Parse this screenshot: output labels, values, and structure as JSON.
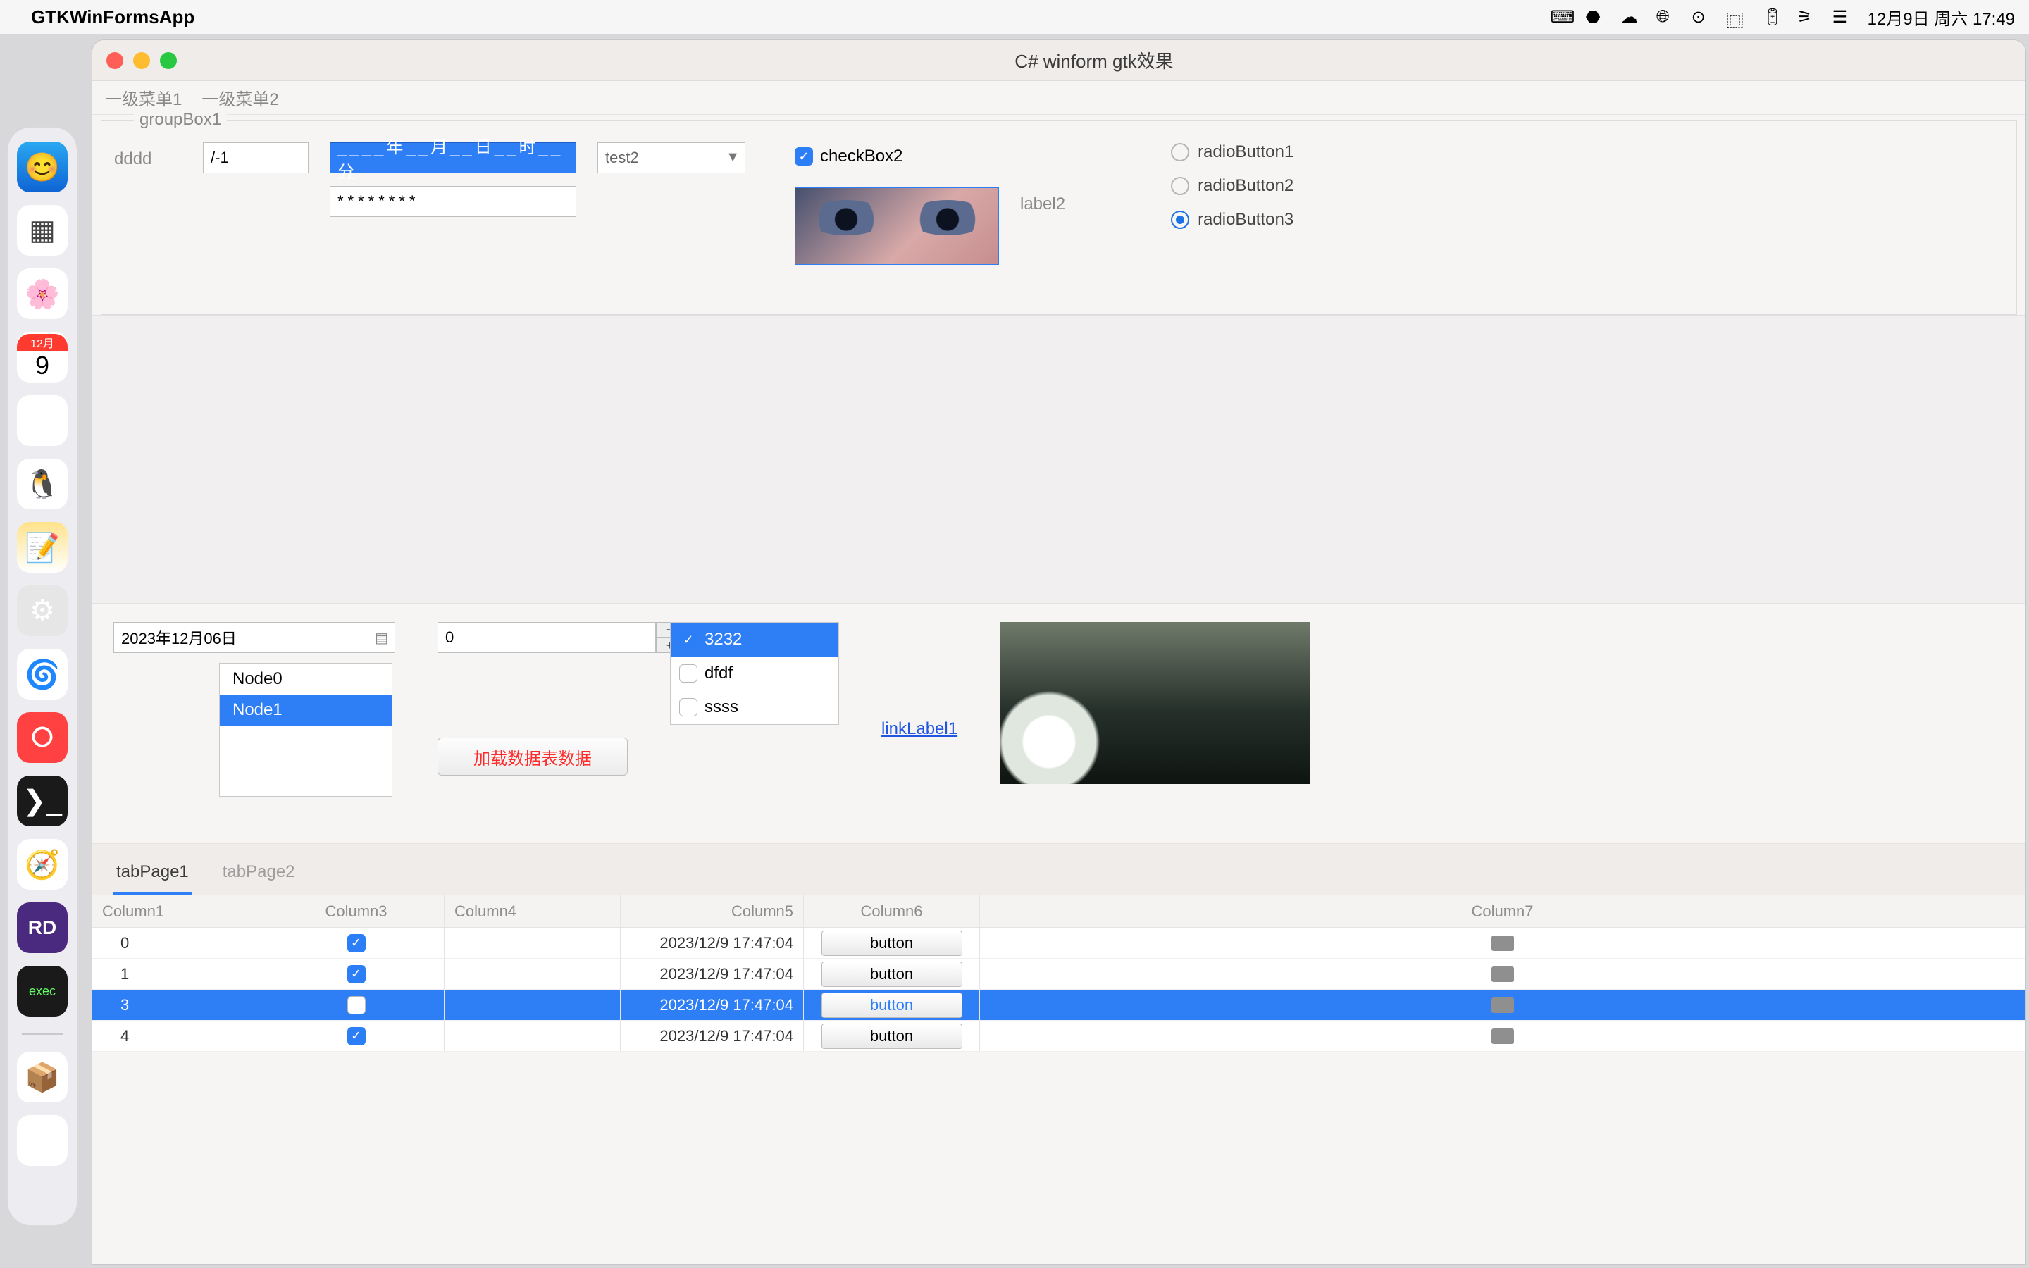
{
  "menubar": {
    "app_name": "GTKWinFormsApp",
    "clock": "12月9日 周六 17:49"
  },
  "dock": {
    "calendar_month": "12月",
    "calendar_day": "9",
    "rd_label": "RD",
    "exec_label": "exec"
  },
  "window": {
    "title": "C# winform gtk效果",
    "menu1": "一级菜单1",
    "menu2": "一级菜单2"
  },
  "group": {
    "legend": "groupBox1",
    "label_dddd": "dddd",
    "textbox1_value": "/-1",
    "datetime_masked": "____年__月__日__时__分",
    "password_value": "********",
    "combo_value": "test2",
    "checkbox2_label": "checkBox2",
    "label2": "label2",
    "radio1": "radioButton1",
    "radio2": "radioButton2",
    "radio3": "radioButton3"
  },
  "controls": {
    "datepicker_value": "2023年12月06日",
    "tree_node0": "Node0",
    "tree_node1": "Node1",
    "spinner_value": "0",
    "load_button": "加载数据表数据",
    "checklist": {
      "i0": "3232",
      "i1": "dfdf",
      "i2": "ssss"
    },
    "linklabel": "linkLabel1"
  },
  "tabs": {
    "tab1": "tabPage1",
    "tab2": "tabPage2",
    "headers": {
      "c1": "Column1",
      "c3": "Column3",
      "c4": "Column4",
      "c5": "Column5",
      "c6": "Column6",
      "c7": "Column7"
    },
    "rows": [
      {
        "c1": "0",
        "checked": true,
        "c5": "2023/12/9 17:47:04",
        "btn": "button"
      },
      {
        "c1": "1",
        "checked": true,
        "c5": "2023/12/9 17:47:04",
        "btn": "button"
      },
      {
        "c1": "3",
        "checked": false,
        "c5": "2023/12/9 17:47:04",
        "btn": "button"
      },
      {
        "c1": "4",
        "checked": true,
        "c5": "2023/12/9 17:47:04",
        "btn": "button"
      }
    ]
  }
}
